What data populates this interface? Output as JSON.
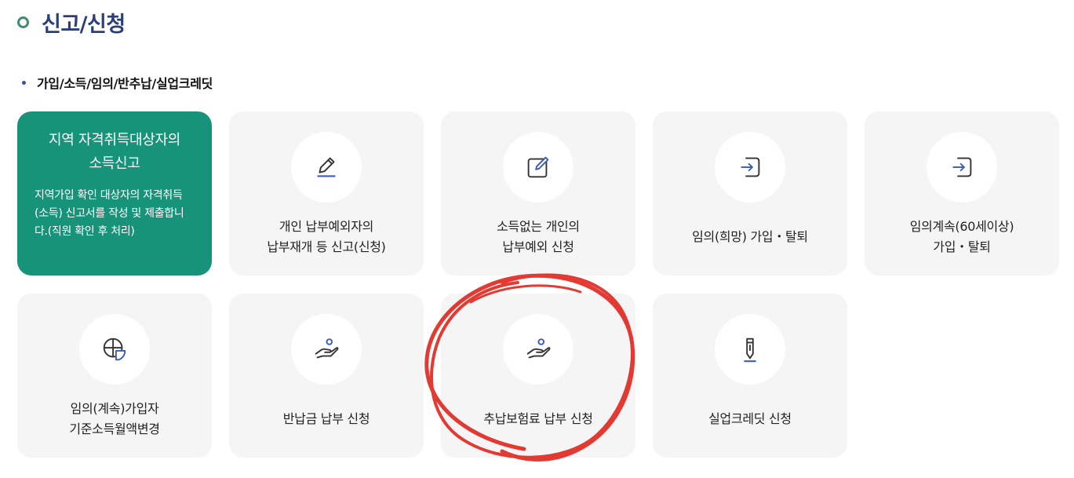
{
  "page": {
    "title": "신고/신청"
  },
  "section": {
    "title": "가입/소득/임의/반추납/실업크레딧"
  },
  "featured_card": {
    "title": "지역 자격취득대상자의\n소득신고",
    "description": "지역가입 확인 대상자의 자격취득(소득) 신고서를 작성 및 제출합니다.(직원 확인 후 처리)"
  },
  "cards": [
    {
      "label": "개인 납부예외자의\n납부재개 등 신고(신청)",
      "icon": "pencil-icon"
    },
    {
      "label": "소득없는 개인의\n납부예외 신청",
      "icon": "edit-box-icon"
    },
    {
      "label": "임의(희망) 가입・탈퇴",
      "icon": "login-arrow-icon"
    },
    {
      "label": "임의계속(60세이상)\n가입・탈퇴",
      "icon": "login-arrow-icon"
    },
    {
      "label": "임의(계속)가입자\n기준소득월액변경",
      "icon": "pie-chart-icon"
    },
    {
      "label": "반납금 납부 신청",
      "icon": "hand-money-icon"
    },
    {
      "label": "추납보험료 납부 신청",
      "icon": "hand-money-icon"
    },
    {
      "label": "실업크레딧 신청",
      "icon": "pen-icon"
    }
  ],
  "colors": {
    "title": "#2c3e7a",
    "featured_bg": "#17937a",
    "card_bg": "#f5f5f5",
    "icon_accent": "#3c5bb8",
    "annotation": "#e0261f"
  }
}
